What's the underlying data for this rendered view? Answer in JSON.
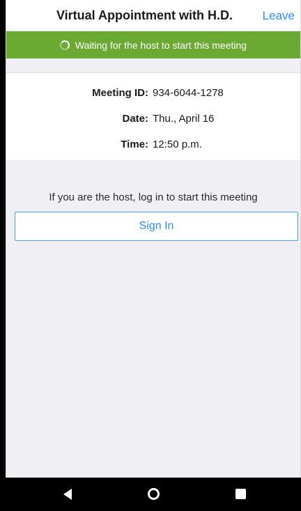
{
  "header": {
    "title": "Virtual Appointment with H.D.",
    "leave_label": "Leave"
  },
  "banner": {
    "text": "Waiting for the host to start this meeting",
    "icon": "spinner-icon",
    "color": "#6aaa33"
  },
  "meeting": {
    "id_label": "Meeting ID:",
    "id_value": "934-6044-1278",
    "date_label": "Date:",
    "date_value": "Thu., April 16",
    "time_label": "Time:",
    "time_value": "12:50 p.m."
  },
  "host": {
    "prompt": "If you are the host, log in to start this meeting",
    "signin_label": "Sign In"
  },
  "navbar": {
    "back_icon": "back-triangle-icon",
    "home_icon": "home-circle-icon",
    "recent_icon": "recent-apps-square-icon"
  },
  "colors": {
    "accent": "#2d8cff",
    "banner": "#6aaa33",
    "background": "#efeff4"
  }
}
